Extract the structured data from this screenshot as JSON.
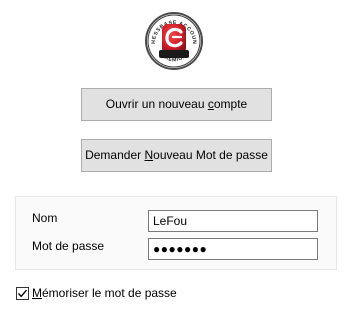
{
  "logo": {
    "icon": "chessbase-account-premium-logo",
    "top_text": "CHESSBASE ACCOUNT",
    "bottom_text": "PREMIUM",
    "colors": {
      "red": "#d0202a",
      "dark_red": "#8e0f16",
      "ring": "#ffffff"
    }
  },
  "buttons": {
    "new_account": {
      "before": "Ouvrir un nouveau ",
      "mnemonic": "c",
      "after": "ompte"
    },
    "new_password": {
      "before": "Demander ",
      "mnemonic": "N",
      "after": "ouveau Mot de passe"
    }
  },
  "form": {
    "name_label": "Nom",
    "name_value": "LeFou",
    "password_label": "Mot de passe",
    "password_value": "●●●●●●●"
  },
  "remember": {
    "before": "",
    "mnemonic": "M",
    "after": "émoriser le mot de passe",
    "checked": true
  }
}
